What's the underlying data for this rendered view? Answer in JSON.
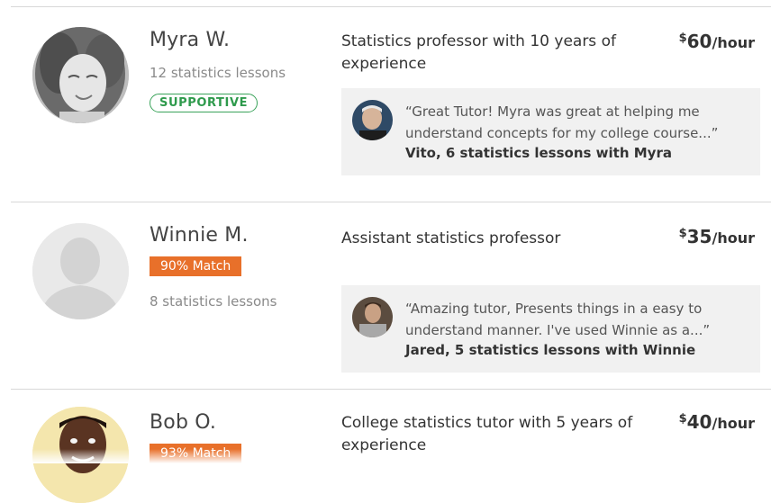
{
  "tutors": [
    {
      "name": "Myra W.",
      "lessons": "12 statistics lessons",
      "badge": "SUPPORTIVE",
      "headline": "Statistics professor with 10 years of experience",
      "price_currency": "$",
      "price_amount": "60",
      "price_unit": "/hour",
      "review_quote": "“Great Tutor! Myra was great at helping me understand concepts for my college course...”",
      "review_author": "Vito, 6 statistics lessons with Myra"
    },
    {
      "name": "Winnie M.",
      "match": "90% Match",
      "lessons": "8 statistics lessons",
      "headline": "Assistant statistics professor",
      "price_currency": "$",
      "price_amount": "35",
      "price_unit": "/hour",
      "review_quote": "“Amazing tutor, Presents things in a easy to understand manner. I've used Winnie as a...”",
      "review_author": "Jared, 5 statistics lessons with Winnie"
    },
    {
      "name": "Bob O.",
      "match": "93% Match",
      "headline": "College statistics tutor with 5 years of experience",
      "price_currency": "$",
      "price_amount": "40",
      "price_unit": "/hour"
    }
  ],
  "colors": {
    "match_badge": "#e8702a",
    "supportive_badge": "#3aa35a",
    "review_bg": "#f1f1f1"
  }
}
